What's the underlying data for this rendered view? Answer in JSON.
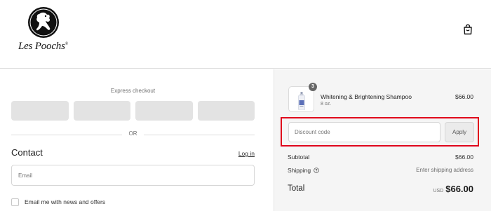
{
  "brand": {
    "logo_text": "Les Poochs",
    "trademark": "®"
  },
  "header": {
    "cart_icon": "shopping-bag-icon"
  },
  "checkout": {
    "express_title": "Express checkout",
    "or_divider": "OR",
    "contact_heading": "Contact",
    "login_link": "Log in",
    "email_placeholder": "Email",
    "newsletter_label": "Email me with news and offers"
  },
  "order": {
    "item": {
      "quantity": "3",
      "name": "Whitening & Brightening Shampoo",
      "variant": "8 oz.",
      "price": "$66.00"
    },
    "discount": {
      "placeholder": "Discount code",
      "apply_label": "Apply"
    },
    "subtotal_label": "Subtotal",
    "subtotal_value": "$66.00",
    "shipping_label": "Shipping",
    "shipping_value": "Enter shipping address",
    "total_label": "Total",
    "currency": "USD",
    "total_value": "$66.00"
  },
  "colors": {
    "highlight": "#e0001b",
    "summary_background": "#f5f5f5"
  }
}
